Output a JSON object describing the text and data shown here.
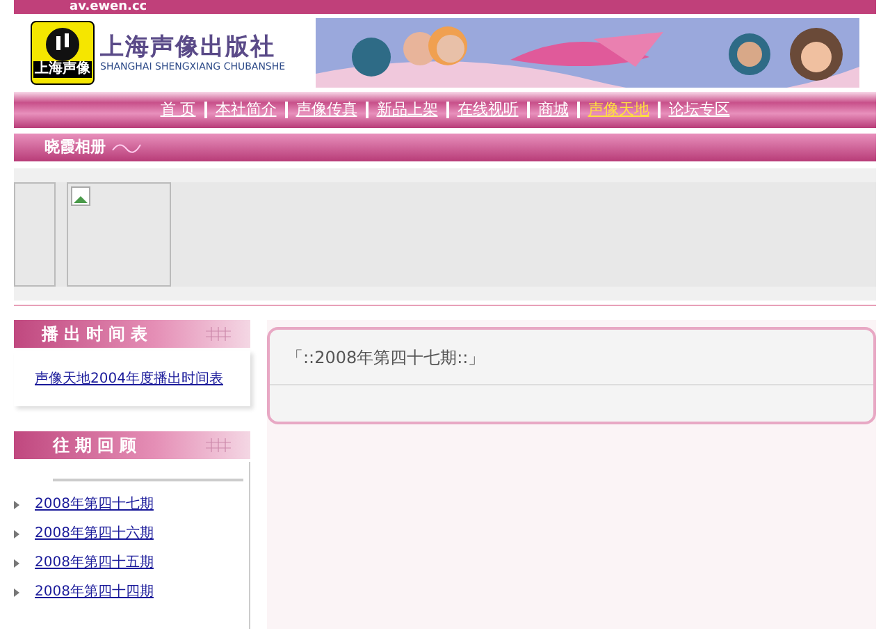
{
  "site_url": "av.ewen.cc",
  "logo": {
    "badge": "上海声像",
    "name": "上海声像出版社",
    "pinyin": "SHANGHAI SHENGXIANG CHUBANSHE"
  },
  "nav": [
    {
      "label": "首 页",
      "selected": false
    },
    {
      "label": "本社简介",
      "selected": false
    },
    {
      "label": "声像传真",
      "selected": false
    },
    {
      "label": "新品上架",
      "selected": false
    },
    {
      "label": "在线视听",
      "selected": false
    },
    {
      "label": "商城",
      "selected": false
    },
    {
      "label": "声像天地",
      "selected": true
    },
    {
      "label": "论坛专区",
      "selected": false
    }
  ],
  "album": {
    "title": "晓霞相册"
  },
  "schedule": {
    "title": "播出时间表",
    "link": "声像天地2004年度播出时间表"
  },
  "archive": {
    "title": "往期回顾",
    "items": [
      "2008年第四十七期",
      "2008年第四十六期",
      "2008年第四十五期",
      "2008年第四十四期"
    ]
  },
  "main_panel": {
    "title": "「::2008年第四十七期::」"
  }
}
